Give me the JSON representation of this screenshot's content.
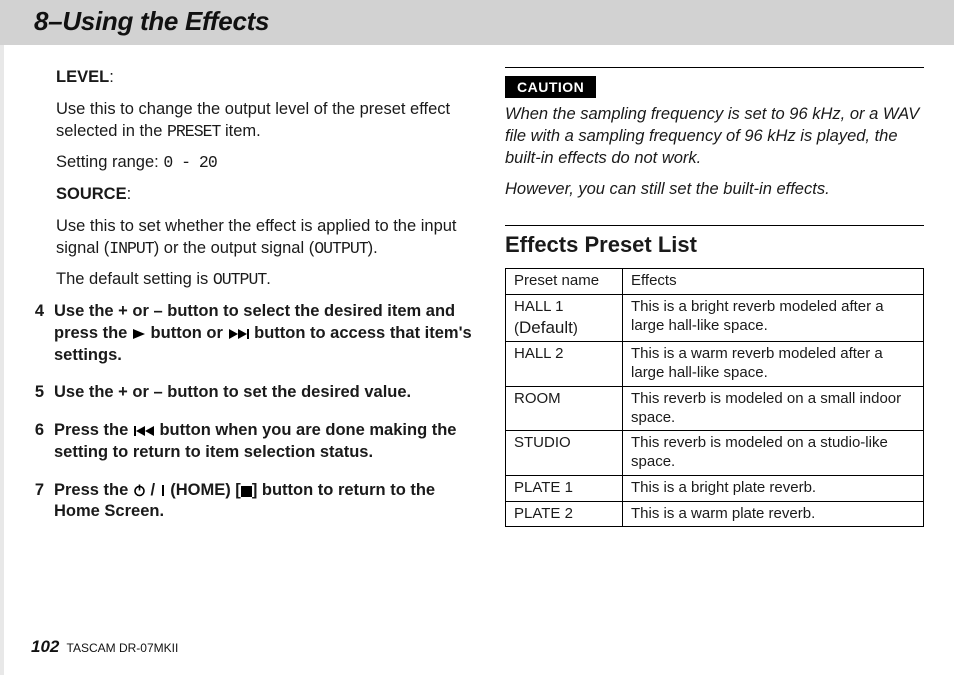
{
  "header": {
    "title": "8–Using the Effects"
  },
  "left": {
    "level_label": "LEVEL",
    "level_text_a": "Use this to change the output level of the preset effect selected in the ",
    "level_preset_word": "PRESET",
    "level_text_b": " item.",
    "setting_range_label": "Setting range: ",
    "setting_range_value": "0 - 20",
    "source_label": "SOURCE",
    "source_text_a": "Use this to set whether the effect is applied to the input signal (",
    "source_input": "INPUT",
    "source_text_mid": ") or the output signal (",
    "source_output": "OUTPUT",
    "source_text_b": ").",
    "default_text_a": "The default setting is ",
    "default_value": "OUTPUT",
    "default_text_b": ".",
    "steps": {
      "s4": {
        "num": "4",
        "a": "Use the + or – button to select the desired item and press the ",
        "b": " button or ",
        "c": " button to access that item's settings."
      },
      "s5": {
        "num": "5",
        "text": "Use the + or – button to set the desired value."
      },
      "s6": {
        "num": "6",
        "a": "Press the ",
        "b": " button when you are done making the setting to return to item selection status."
      },
      "s7": {
        "num": "7",
        "a": "Press the ",
        "home": "(HOME) [",
        "b": "] button to return to the Home Screen."
      }
    }
  },
  "right": {
    "caution_label": "CAUTION",
    "caution_p1": "When the sampling frequency is set to 96 kHz, or a WAV file with a sampling frequency of 96 kHz is played, the built-in effects do not work.",
    "caution_p2": "However, you can still set the built-in effects.",
    "section": "Effects Preset List",
    "table": {
      "h1": "Preset name",
      "h2": "Effects",
      "rows": [
        {
          "name_a": "HALL 1 (",
          "name_default": "Default",
          "name_b": ")",
          "desc": "This is a bright reverb modeled after a large hall-like space."
        },
        {
          "name_a": "HALL 2",
          "name_default": "",
          "name_b": "",
          "desc": "This is a warm reverb modeled after a large hall-like space."
        },
        {
          "name_a": "ROOM",
          "name_default": "",
          "name_b": "",
          "desc": "This reverb is modeled on a small indoor space."
        },
        {
          "name_a": "STUDIO",
          "name_default": "",
          "name_b": "",
          "desc": "This reverb is modeled on a studio-like space."
        },
        {
          "name_a": "PLATE 1",
          "name_default": "",
          "name_b": "",
          "desc": "This is a bright plate reverb."
        },
        {
          "name_a": "PLATE 2",
          "name_default": "",
          "name_b": "",
          "desc": "This is a warm plate reverb."
        }
      ]
    }
  },
  "footer": {
    "page": "102",
    "model": "TASCAM DR-07MKII"
  }
}
